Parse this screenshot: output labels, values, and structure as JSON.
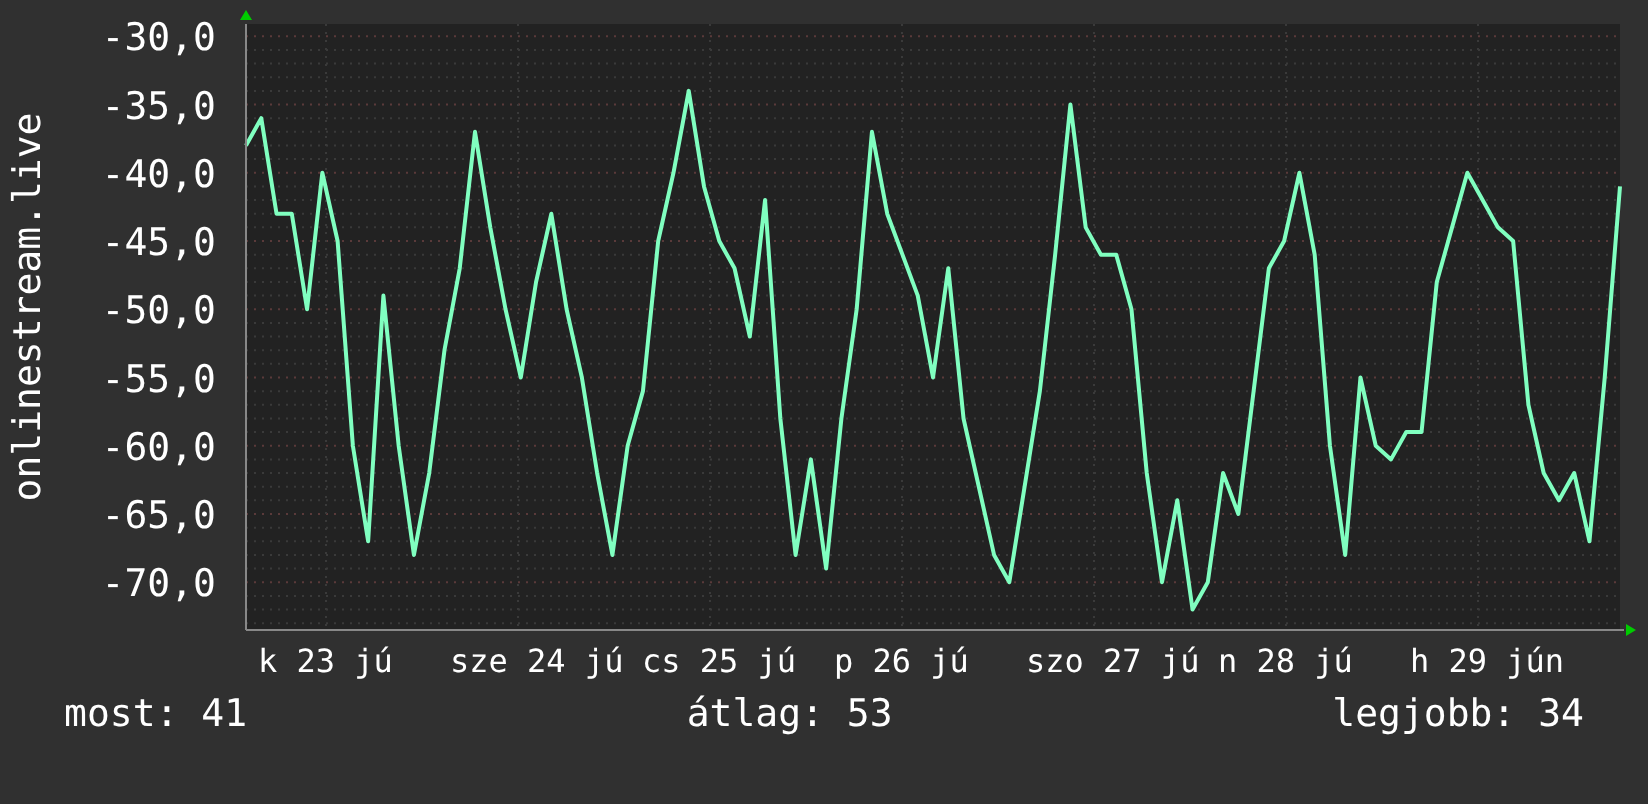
{
  "chart": {
    "chart_data": {
      "type": "line",
      "ylabel": "onlinestream.live",
      "ylim": [
        -73.5,
        -29.1
      ],
      "grid": true,
      "yticks": [
        {
          "value": -30,
          "label": "-30,0"
        },
        {
          "value": -35,
          "label": "-35,0"
        },
        {
          "value": -40,
          "label": "-40,0"
        },
        {
          "value": -45,
          "label": "-45,0"
        },
        {
          "value": -50,
          "label": "-50,0"
        },
        {
          "value": -55,
          "label": "-55,0"
        },
        {
          "value": -60,
          "label": "-60,0"
        },
        {
          "value": -65,
          "label": "-65,0"
        },
        {
          "value": -70,
          "label": "-70,0"
        }
      ],
      "series": [
        {
          "color": "#80ffc0",
          "values": [
            -38,
            -36,
            -43,
            -43,
            -50,
            -40,
            -45,
            -60,
            -67,
            -49,
            -60,
            -68,
            -62,
            -53,
            -47,
            -37,
            -44,
            -50,
            -55,
            -48,
            -43,
            -50,
            -55,
            -62,
            -68,
            -60,
            -56,
            -45,
            -40,
            -34,
            -41,
            -45,
            -47,
            -52,
            -42,
            -58,
            -68,
            -61,
            -69,
            -58,
            -50,
            -37,
            -43,
            -46,
            -49,
            -55,
            -47,
            -58,
            -63,
            -68,
            -70,
            -63,
            -56,
            -46,
            -35,
            -44,
            -46,
            -46,
            -50,
            -62,
            -70,
            -64,
            -72,
            -70,
            -62,
            -65,
            -56,
            -47,
            -45,
            -40,
            -46,
            -60,
            -68,
            -55,
            -60,
            -61,
            -59,
            -59,
            -48,
            -44,
            -40,
            -42,
            -44,
            -45,
            -57,
            -62,
            -64,
            -62,
            -67,
            -55,
            -41
          ]
        }
      ]
    },
    "x_labels": [
      "k 23 jú",
      "sze 24 jú",
      "cs 25 jú",
      "p 26 jú",
      "szo 27 jú",
      "n 28 jú",
      "h 29 jún"
    ]
  },
  "legend": [
    {
      "label": "most: 41"
    },
    {
      "label": "átlag: 53"
    },
    {
      "label": "legjobb: 34"
    }
  ]
}
